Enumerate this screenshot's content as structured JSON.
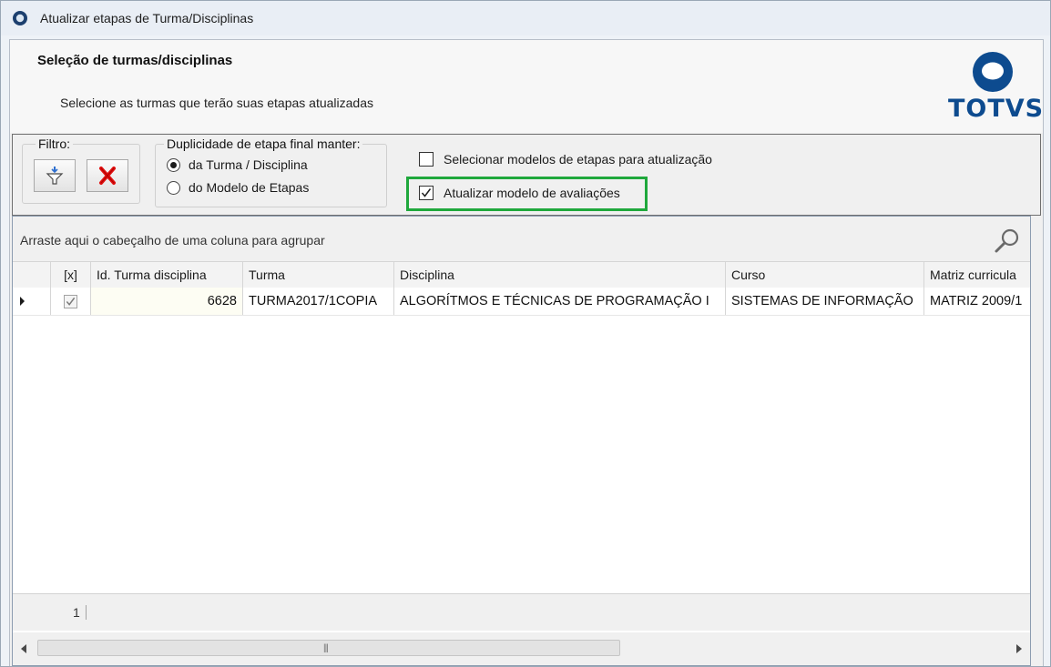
{
  "window": {
    "title": "Atualizar etapas de Turma/Disciplinas"
  },
  "header": {
    "title": "Seleção de turmas/disciplinas",
    "subtitle": "Selecione as turmas que terão suas etapas atualizadas",
    "logo_text": "TOTVS",
    "brand_color": "#0d4b8f"
  },
  "filter": {
    "legend": "Filtro:",
    "buttons": [
      {
        "icon": "filter-icon"
      },
      {
        "icon": "clear-filter-icon"
      }
    ]
  },
  "duplicity": {
    "legend": "Duplicidade de etapa final manter:",
    "options": [
      {
        "label": "da Turma / Disciplina",
        "selected": true
      },
      {
        "label": "do Modelo de Etapas",
        "selected": false
      }
    ]
  },
  "options": {
    "select_models": {
      "label": "Selecionar modelos de etapas para atualização",
      "checked": false
    },
    "update_evaluation_model": {
      "label": "Atualizar modelo de avaliações",
      "checked": true
    },
    "highlight_color": "#1fa83c"
  },
  "grid": {
    "group_panel_text": "Arraste aqui o cabeçalho de uma coluna para agrupar",
    "columns": [
      "[x]",
      "Id. Turma disciplina",
      "Turma",
      "Disciplina",
      "Curso",
      "Matriz curricula"
    ],
    "rows": [
      {
        "selected": true,
        "id": "6628",
        "turma": "TURMA2017/1COPIA",
        "disciplina": "ALGORÍTMOS E TÉCNICAS DE PROGRAMAÇÃO I",
        "curso": "SISTEMAS DE INFORMAÇÃO",
        "matriz": "MATRIZ 2009/1"
      }
    ],
    "record_count": "1"
  }
}
